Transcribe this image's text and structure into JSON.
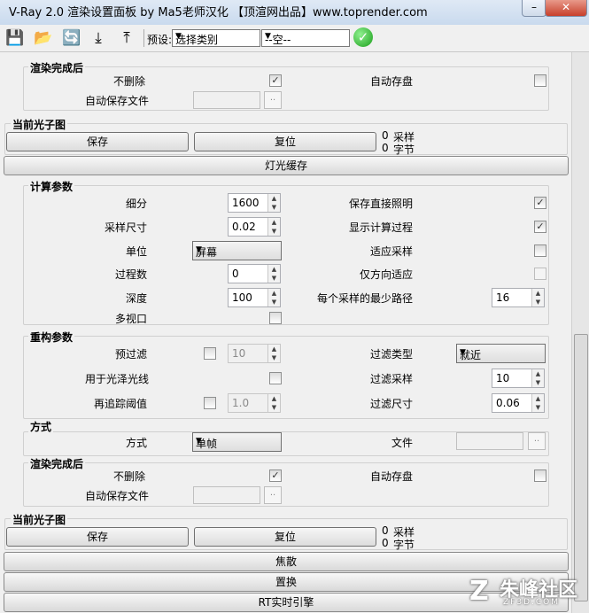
{
  "window": {
    "title": "V-Ray 2.0 渲染设置面板 by Ma5老师汉化 【顶渲网出品】www.toprender.com",
    "minimize": "–",
    "close": "✕"
  },
  "toolbar": {
    "preset_label": "预设:",
    "preset_value": "选择类别",
    "preset2_value": "--空--",
    "ok": "✓"
  },
  "save_after_render_1": {
    "title": "渲染完成后",
    "dont_delete": "不删除",
    "auto_save": "自动存盘",
    "auto_save_file": "自动保存文件",
    "dots": ".."
  },
  "current_photon_map_1": {
    "title": "当前光子图",
    "save": "保存",
    "reset": "复位",
    "samples_count": "0",
    "samples_label": "采样",
    "bytes_count": "0",
    "bytes_label": "字节"
  },
  "light_cache_rollout": "灯光缓存",
  "calc_params": {
    "title": "计算参数",
    "subdivs_label": "细分",
    "subdivs": "1600",
    "sample_size_label": "采样尺寸",
    "sample_size": "0.02",
    "scale_label": "单位",
    "scale": "屏幕",
    "passes_label": "过程数",
    "passes": "0",
    "depth_label": "深度",
    "depth": "100",
    "multiview_label": "多视口",
    "store_direct_label": "保存直接照明",
    "show_calc_label": "显示计算过程",
    "adaptive_label": "适应采样",
    "dir_only_label": "仅方向适应",
    "min_paths_label": "每个采样的最少路径",
    "min_paths": "16"
  },
  "reconstruct_params": {
    "title": "重构参数",
    "prefilter_label": "预过滤",
    "prefilter": "10",
    "glossy_label": "用于光泽光线",
    "retrace_label": "再追踪阈值",
    "retrace": "1.0",
    "filter_type_label": "过滤类型",
    "filter_type": "就近",
    "filter_samples_label": "过滤采样",
    "filter_samples": "10",
    "filter_size_label": "过滤尺寸",
    "filter_size": "0.06"
  },
  "mode": {
    "title": "方式",
    "mode_label": "方式",
    "mode_value": "单帧",
    "file_label": "文件",
    "dots": ".."
  },
  "save_after_render_2": {
    "title": "渲染完成后",
    "dont_delete": "不删除",
    "auto_save": "自动存盘",
    "auto_save_file": "自动保存文件",
    "dots": ".."
  },
  "current_photon_map_2": {
    "title": "当前光子图",
    "save": "保存",
    "reset": "复位",
    "samples_count": "0",
    "samples_label": "采样",
    "bytes_count": "0",
    "bytes_label": "字节"
  },
  "caustics_rollout": "焦散",
  "displacement_rollout": "置换",
  "rt_engine_rollout": "RT实时引擎",
  "watermark": {
    "text": "朱峰社区",
    "sub": "ZF3D.COM"
  }
}
